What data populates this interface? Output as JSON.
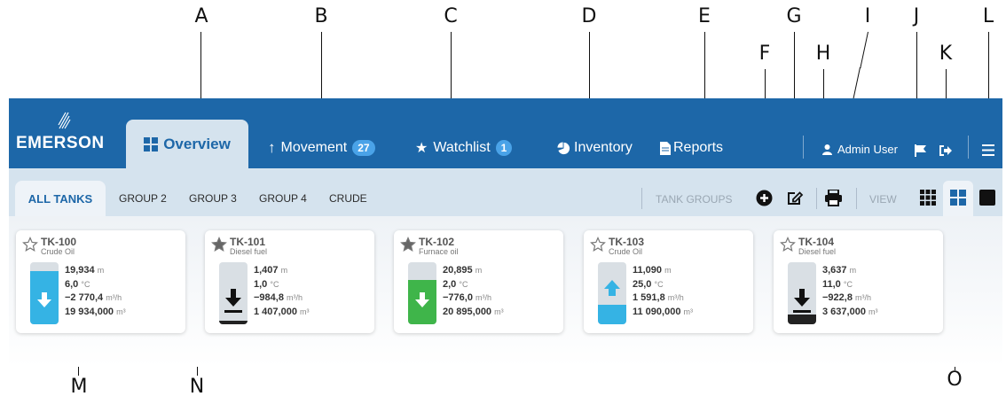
{
  "callouts": {
    "A": "A",
    "B": "B",
    "C": "C",
    "D": "D",
    "E": "E",
    "F": "F",
    "G": "G",
    "H": "H",
    "I": "I",
    "J": "J",
    "K": "K",
    "L": "L",
    "M": "M",
    "N": "N",
    "O": "O"
  },
  "brand": {
    "logo_text": "EMERSON"
  },
  "nav": {
    "overview": "Overview",
    "movement": "Movement",
    "movement_count": "27",
    "watchlist": "Watchlist",
    "watchlist_count": "1",
    "inventory": "Inventory",
    "reports": "Reports"
  },
  "user": {
    "name": "Admin User"
  },
  "groups": {
    "all": "ALL TANKS",
    "items": [
      "GROUP 2",
      "GROUP 3",
      "GROUP 4",
      "CRUDE"
    ]
  },
  "toolbar": {
    "tank_groups": "TANK GROUPS",
    "view": "VIEW"
  },
  "tanks": [
    {
      "name": "TK-100",
      "product": "Crude Oil",
      "starred": false,
      "level": "19,934",
      "level_unit": "m",
      "temp": "6,0",
      "temp_unit": "°C",
      "flow": "−2 770,4",
      "flow_unit": "m³/h",
      "volume": "19 934,000",
      "volume_unit": "m³",
      "fill_fraction": 0.86,
      "fill_color": "#35b3e4",
      "direction": "down"
    },
    {
      "name": "TK-101",
      "product": "Diesel fuel",
      "starred": true,
      "level": "1,407",
      "level_unit": "m",
      "temp": "1,0",
      "temp_unit": "°C",
      "flow": "−984,8",
      "flow_unit": "m³/h",
      "volume": "1 407,000",
      "volume_unit": "m³",
      "fill_fraction": 0.06,
      "fill_color": "#222222",
      "direction": "down"
    },
    {
      "name": "TK-102",
      "product": "Furnace oil",
      "starred": true,
      "level": "20,895",
      "level_unit": "m",
      "temp": "2,0",
      "temp_unit": "°C",
      "flow": "−776,0",
      "flow_unit": "m³/h",
      "volume": "20 895,000",
      "volume_unit": "m³",
      "fill_fraction": 0.72,
      "fill_color": "#3fb54a",
      "direction": "down"
    },
    {
      "name": "TK-103",
      "product": "Crude Oil",
      "starred": false,
      "level": "11,090",
      "level_unit": "m",
      "temp": "25,0",
      "temp_unit": "°C",
      "flow": "1 591,8",
      "flow_unit": "m³/h",
      "volume": "11 090,000",
      "volume_unit": "m³",
      "fill_fraction": 0.32,
      "fill_color": "#35b3e4",
      "direction": "up"
    },
    {
      "name": "TK-104",
      "product": "Diesel fuel",
      "starred": false,
      "level": "3,637",
      "level_unit": "m",
      "temp": "11,0",
      "temp_unit": "°C",
      "flow": "−922,8",
      "flow_unit": "m³/h",
      "volume": "3 637,000",
      "volume_unit": "m³",
      "fill_fraction": 0.16,
      "fill_color": "#222222",
      "direction": "down"
    }
  ]
}
